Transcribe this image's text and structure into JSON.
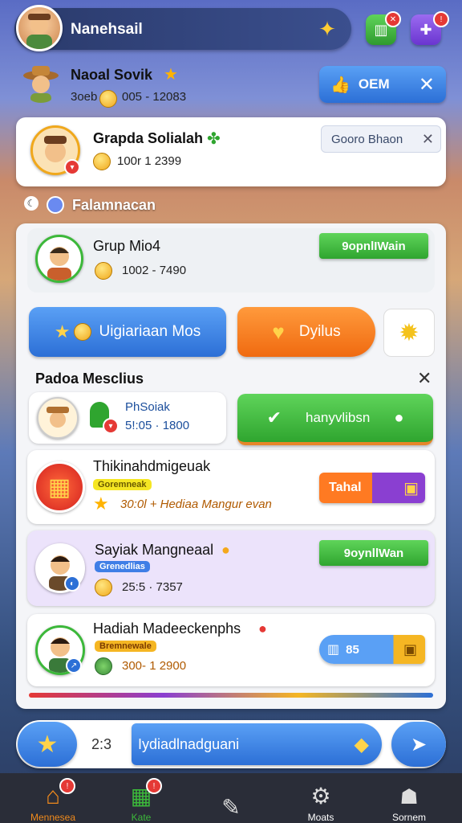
{
  "topbar": {
    "title": "Nanehsail"
  },
  "player": {
    "name": "Naoal Sovik",
    "stat_a": "3oeb",
    "stat_b": "005 - 12083",
    "action_label": "OEM"
  },
  "featured": {
    "name": "Grapda Solialah",
    "stat": "100r 1 2399",
    "action_label": "Gooro Bhaon"
  },
  "section_title": "Falamnacan",
  "group": {
    "name": "Grup Mio4",
    "stat": "1002 - 7490",
    "action_label": "9opnlIWain"
  },
  "actions": {
    "blue_label": "Uigiariaan Mos",
    "orange_label": "Dyilus"
  },
  "list": {
    "title": "Padoa Mesclius",
    "highlight": {
      "name": "PhSoiak",
      "stat": "5!:05 · 1800",
      "action_label": "hanyvlibsn"
    },
    "items": [
      {
        "name": "Thikinahdmigeuak",
        "tag": "Goremneak",
        "stat": "30:0l + Hediaa Mangur evan",
        "action_label": "Tahal"
      },
      {
        "name": "Sayiak Mangneaal",
        "tag": "Grenedlias",
        "stat": "25:5 · 7357",
        "action_label": "9oynllWan"
      },
      {
        "name": "Hadiah Madeeckenphs",
        "tag": "Bremnewale",
        "stat": "300- 1 2900",
        "action_label": "85"
      }
    ]
  },
  "chatbar": {
    "time": "2:3",
    "message": "Iydiadlnadguani"
  },
  "nav": [
    {
      "label": "Mennesea"
    },
    {
      "label": "Kate"
    },
    {
      "label": ""
    },
    {
      "label": "Moats"
    },
    {
      "label": "Sornem"
    }
  ],
  "colors": {
    "green": "#3cb83a",
    "blue": "#2c6fd6",
    "orange": "#f06a10",
    "purple": "#8a3fd1",
    "lavender": "#ece3fb"
  }
}
